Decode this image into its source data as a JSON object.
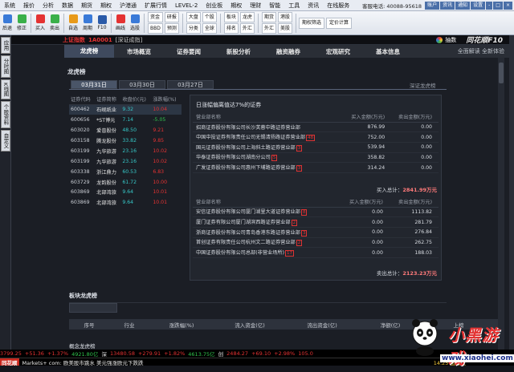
{
  "menu": {
    "items": [
      "系统",
      "报价",
      "分析",
      "数据",
      "期货",
      "期权",
      "沪港通",
      "扩展行情",
      "LEVEL-2",
      "创业板",
      "期权",
      "理财",
      "智能",
      "工具",
      "资讯",
      "在线服务"
    ],
    "hotline": "客服电话: 40088-95618",
    "winbtns": [
      "账户",
      "资讯",
      "通知",
      "设置",
      "-",
      "□",
      "×"
    ]
  },
  "toolbar": {
    "buttons": [
      {
        "label": "后退",
        "icon": "back-icon",
        "color": "#3a7ad8"
      },
      {
        "label": "修正",
        "icon": "refresh-icon",
        "color": "#3ab04a"
      },
      {
        "label": "买入",
        "icon": "buy-icon",
        "color": "#e43232"
      },
      {
        "label": "卖出",
        "icon": "sell-icon",
        "color": "#3ab04a"
      },
      {
        "label": "自选",
        "icon": "star-icon",
        "color": "#e89a1a"
      },
      {
        "label": "周期",
        "icon": "period-icon",
        "color": "#3a7ad8"
      },
      {
        "label": "F10",
        "icon": "f10-icon",
        "color": "#2a5aa8"
      },
      {
        "label": "画线",
        "icon": "draw-icon",
        "color": "#e43232"
      },
      {
        "label": "选股",
        "icon": "filter-icon",
        "color": "#3a7ad8"
      }
    ],
    "groups": [
      [
        "资金",
        "研报",
        "BBD",
        "预测"
      ],
      [
        "大盘",
        "个股",
        "分类",
        "全球"
      ],
      [
        "板块",
        "龙虎",
        "排名",
        "外汇"
      ],
      [
        "期货",
        "港股",
        "外汇",
        "美股"
      ]
    ],
    "extra": [
      "期权筛选",
      "定价计算"
    ]
  },
  "lefttabs": [
    "应用",
    "分时图",
    "K线图",
    "个股资料",
    "自定义"
  ],
  "header": {
    "code_label": "上证指数",
    "code": "1A0001",
    "subtitle": "[深证成指]",
    "brand_pre": "抽数",
    "brand": "同花顺F10"
  },
  "nav": {
    "items": [
      "龙虎榜",
      "市场概览",
      "证券要闻",
      "新股分析",
      "融资融券",
      "宏观研究",
      "基本信息"
    ],
    "active": "龙虎榜",
    "right": "全面解读 全新体验"
  },
  "section1": {
    "title": "龙虎榜",
    "dates": [
      "03月31日",
      "03月30日",
      "03月27日"
    ],
    "right": "深证龙虎榜"
  },
  "stocks": {
    "headers": [
      "证券代码",
      "证券简称",
      "收盘价(元)",
      "涨跌幅(%)"
    ],
    "rows": [
      [
        "600462",
        "石岘纸业",
        "9.32",
        "10.04",
        "up"
      ],
      [
        "600656",
        "*ST博元",
        "7.14",
        "-5.05",
        "dn"
      ],
      [
        "603020",
        "爱普股份",
        "48.50",
        "9.21",
        "up"
      ],
      [
        "603158",
        "腾龙股份",
        "33.82",
        "9.85",
        "up"
      ],
      [
        "603199",
        "九华旅游",
        "23.16",
        "10.02",
        "up"
      ],
      [
        "603199",
        "九华旅游",
        "23.16",
        "10.02",
        "up"
      ],
      [
        "603338",
        "浙江鼎力",
        "60.53",
        "6.83",
        "up"
      ],
      [
        "603729",
        "龙韵股份",
        "61.72",
        "10.00",
        "up"
      ],
      [
        "603869",
        "北部湾旅",
        "9.64",
        "10.01",
        "up"
      ],
      [
        "603869",
        "北部湾旅",
        "9.64",
        "10.01",
        "up"
      ]
    ]
  },
  "detail": {
    "title": "日涨幅偏离值达7%的证券",
    "buy": {
      "headers": [
        "营业部名称",
        "买入金额(万元)",
        "卖出金额(万元)"
      ],
      "rows": [
        [
          "招商证券股份有限公司长沙芙蓉中路证券营业部",
          "",
          "876.99",
          "0.00"
        ],
        [
          "中国中投证券有限责任公司无锡清扬路证券营业部",
          "48",
          "752.00",
          "0.00"
        ],
        [
          "国元证券股份有限公司上海斜土路证券营业部",
          "3",
          "539.94",
          "0.00"
        ],
        [
          "华泰证券股份有限公司湖南分公司",
          "5",
          "358.82",
          "0.00"
        ],
        [
          "广发证券股份有限公司惠州下埔路证券营业部",
          "3",
          "314.24",
          "0.00"
        ]
      ],
      "total_label": "买入总计：",
      "total": "2841.99万元"
    },
    "sell": {
      "headers": [
        "营业部名称",
        "买入金额(万元)",
        "卖出金额(万元)"
      ],
      "rows": [
        [
          "安信证券股份有限公司厦门湖里大道证券营业部",
          "8",
          "0.00",
          "1113.82"
        ],
        [
          "厦门证券有限公司厦门湖滨西路证券营业部",
          "2",
          "0.00",
          "281.79"
        ],
        [
          "浙商证券股份有限公司青岛香港东路证券营业部",
          "3",
          "0.00",
          "276.84"
        ],
        [
          "首创证券有限责任公司杭州文二路证券营业部",
          "2",
          "0.00",
          "262.75"
        ],
        [
          "中国证券股份有限公司总部(非营业场所)",
          "17",
          "0.00",
          "188.03"
        ]
      ],
      "total_label": "卖出总计：",
      "total": "2123.23万元"
    }
  },
  "section2": {
    "title": "板块龙虎榜",
    "headers": [
      "序号",
      "行业",
      "涨跌幅(%)",
      "流入资金(亿)",
      "流出资金(亿)",
      "净额(亿)",
      "上榜"
    ]
  },
  "section3": {
    "title": "概念龙虎榜"
  },
  "ticker": [
    "3799.25",
    "+51.36",
    "+1.37%",
    "4921.80亿",
    "深",
    "13480.58",
    "+279.91",
    "+1.82%",
    "4613.75亿",
    "创",
    "2484.27",
    "+69.10",
    "+2.98%",
    "105.0"
  ],
  "status": {
    "logo": "同花顺",
    "text": "Markets+ com:  欧美股市跳水 美元强涨欧元下跌跌",
    "time": "14:25 国行大"
  },
  "watermark": {
    "text": "小黑游戏",
    "url": "www.xiaohei.com"
  }
}
